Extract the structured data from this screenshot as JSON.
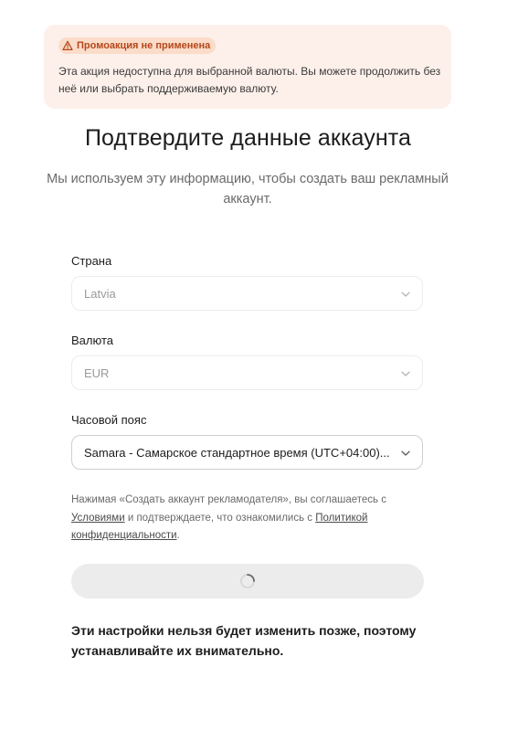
{
  "promo": {
    "badge": "Промоакция не применена",
    "description": "Эта акция недоступна для выбранной валюты. Вы можете продолжить без неё или выбрать поддерживаемую валюту."
  },
  "header": {
    "title": "Подтвердите данные аккаунта",
    "subtitle": "Мы используем эту информацию, чтобы создать ваш рекламный аккаунт."
  },
  "form": {
    "country": {
      "label": "Страна",
      "value": "Latvia"
    },
    "currency": {
      "label": "Валюта",
      "value": "EUR"
    },
    "timezone": {
      "label": "Часовой пояс",
      "value": "Samara - Самарское стандартное время (UTC+04:00)..."
    }
  },
  "legal": {
    "prefix": "Нажимая «Создать аккаунт рекламодателя», вы соглашаетесь с",
    "terms_link": "Условиями",
    "middle": "и подтверждаете, что ознакомились с",
    "privacy_link": "Политикой конфиденциальности",
    "suffix": "."
  },
  "footer": {
    "note": "Эти настройки нельзя будет изменить позже, поэтому устанавливайте их внимательно."
  },
  "colors": {
    "promo_bg": "#fdf0ea",
    "promo_badge_bg": "#fbdcc9",
    "promo_badge_text": "#b5471b",
    "button_disabled": "#ececec"
  },
  "icons": {
    "promo": "warning-triangle-icon",
    "select": "chevron-down-icon",
    "loading": "spinner-icon"
  }
}
